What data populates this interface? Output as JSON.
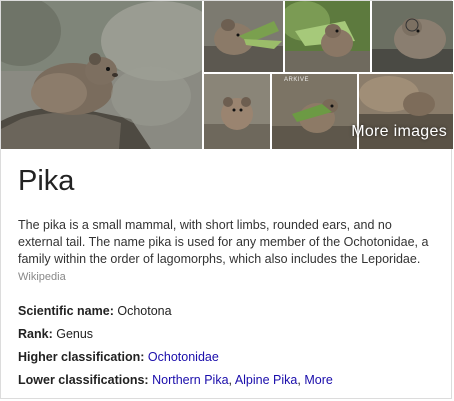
{
  "images": {
    "more_images_label": "More images",
    "watermark": "ARKIVE"
  },
  "title": "Pika",
  "description": {
    "text": "The pika is a small mammal, with short limbs, rounded ears, and no external tail. The name pika is used for any member of the Ochotonidae, a family within the order of lagomorphs, which also includes the Leporidae.",
    "source": "Wikipedia"
  },
  "facts": {
    "scientific_name": {
      "label": "Scientific name:",
      "value": "Ochotona"
    },
    "rank": {
      "label": "Rank:",
      "value": "Genus"
    },
    "higher_classification": {
      "label": "Higher classification:",
      "value": "Ochotonidae"
    },
    "lower_classifications": {
      "label": "Lower classifications:",
      "links": [
        "Northern Pika",
        "Alpine Pika",
        "More"
      ],
      "separator": ","
    }
  },
  "colors": {
    "link": "#1a0dab",
    "source": "#888888",
    "text": "#222222"
  }
}
